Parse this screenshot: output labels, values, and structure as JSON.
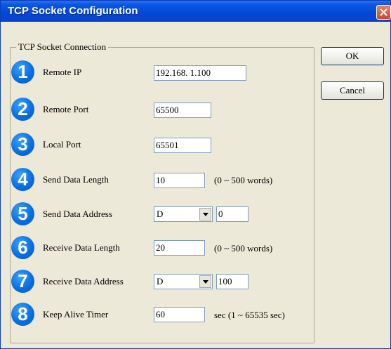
{
  "window": {
    "title": "TCP Socket Configuration"
  },
  "group": {
    "label": "TCP Socket Connection"
  },
  "buttons": {
    "ok": "OK",
    "cancel": "Cancel"
  },
  "colors": {
    "badge": "#0a6fe0",
    "titlebar": "#0447d4",
    "dialog_bg": "#ece9d8"
  },
  "rows": {
    "remote_ip": {
      "badge": "1",
      "label": "Remote IP",
      "value": "192.168.  1.100"
    },
    "remote_port": {
      "badge": "2",
      "label": "Remote Port",
      "value": "65500"
    },
    "local_port": {
      "badge": "3",
      "label": "Local Port",
      "value": "65501"
    },
    "send_len": {
      "badge": "4",
      "label": "Send Data Length",
      "value": "10",
      "hint": "(0 ~ 500 words)"
    },
    "send_addr": {
      "badge": "5",
      "label": "Send Data Address",
      "device": "D",
      "value": "0"
    },
    "recv_len": {
      "badge": "6",
      "label": "Receive Data Length",
      "value": "20",
      "hint": "(0 ~ 500 words)"
    },
    "recv_addr": {
      "badge": "7",
      "label": "Receive Data Address",
      "device": "D",
      "value": "100"
    },
    "keep_alive": {
      "badge": "8",
      "label": "Keep Alive Timer",
      "value": "60",
      "hint": "sec (1 ~ 65535 sec)"
    }
  }
}
